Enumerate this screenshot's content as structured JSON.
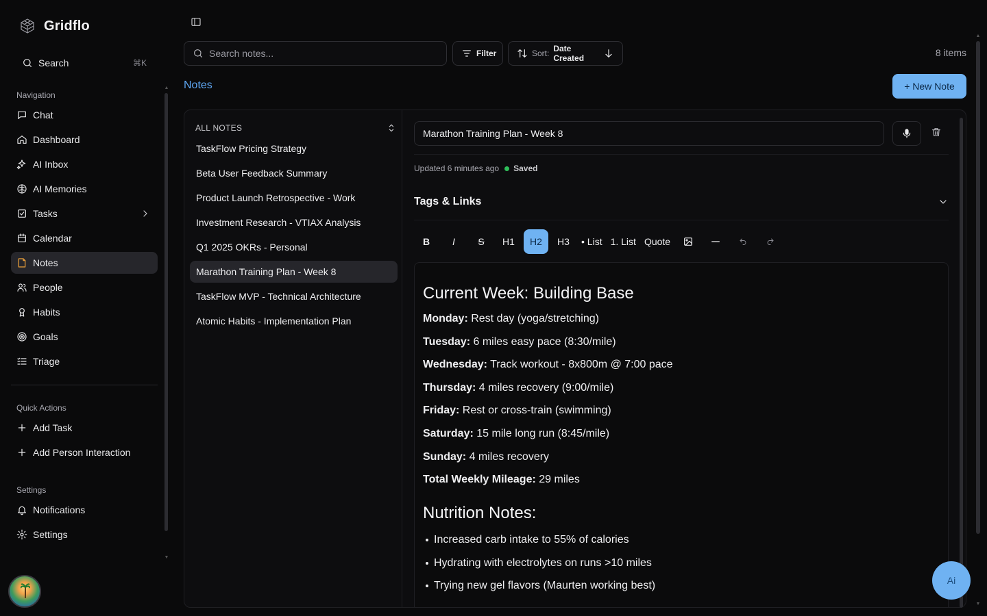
{
  "app": {
    "name": "Gridflo"
  },
  "sidebar": {
    "search": {
      "label": "Search",
      "shortcut": "⌘K"
    },
    "navigation_title": "Navigation",
    "nav_items": [
      {
        "label": "Chat",
        "icon": "chat-icon"
      },
      {
        "label": "Dashboard",
        "icon": "home-icon"
      },
      {
        "label": "AI Inbox",
        "icon": "sparkles-icon"
      },
      {
        "label": "AI Memories",
        "icon": "brain-icon"
      },
      {
        "label": "Tasks",
        "icon": "checkbox-icon"
      },
      {
        "label": "Calendar",
        "icon": "calendar-icon"
      },
      {
        "label": "Notes",
        "icon": "note-icon",
        "active": true
      },
      {
        "label": "People",
        "icon": "people-icon"
      },
      {
        "label": "Habits",
        "icon": "award-icon"
      },
      {
        "label": "Goals",
        "icon": "target-icon"
      },
      {
        "label": "Triage",
        "icon": "list-check-icon"
      }
    ],
    "quick_actions_title": "Quick Actions",
    "quick_actions": [
      {
        "label": "Add Task",
        "icon": "plus-icon"
      },
      {
        "label": "Add Person Interaction",
        "icon": "plus-icon"
      }
    ],
    "settings_title": "Settings",
    "settings_items": [
      {
        "label": "Notifications",
        "icon": "bell-icon"
      },
      {
        "label": "Settings",
        "icon": "gear-icon"
      }
    ]
  },
  "toolbar": {
    "search_placeholder": "Search notes...",
    "filter_label": "Filter",
    "sort_prefix": "Sort:",
    "sort_value": "Date Created",
    "item_count": "8 items"
  },
  "page": {
    "title": "Notes",
    "new_note_label": "+ New Note"
  },
  "notes_list": {
    "header": "ALL NOTES",
    "items": [
      "TaskFlow Pricing Strategy",
      "Beta User Feedback Summary",
      "Product Launch Retrospective - Work",
      "Investment Research - VTIAX Analysis",
      "Q1 2025 OKRs - Personal",
      "Marathon Training Plan - Week 8",
      "TaskFlow MVP - Technical Architecture",
      "Atomic Habits - Implementation Plan"
    ],
    "active_index": 5
  },
  "editor": {
    "title_value": "Marathon Training Plan - Week 8",
    "updated_text": "Updated 6 minutes ago",
    "saved_text": "Saved",
    "tags_label": "Tags & Links",
    "format_buttons": [
      "B",
      "I",
      "S",
      "H1",
      "H2",
      "H3",
      "• List",
      "1. List",
      "Quote"
    ],
    "active_format": "H2",
    "content": {
      "heading1": "Current Week: Building Base",
      "schedule": [
        {
          "day": "Monday:",
          "text": " Rest day (yoga/stretching)"
        },
        {
          "day": "Tuesday:",
          "text": " 6 miles easy pace (8:30/mile)"
        },
        {
          "day": "Wednesday:",
          "text": " Track workout - 8x800m @ 7:00 pace"
        },
        {
          "day": "Thursday:",
          "text": " 4 miles recovery (9:00/mile)"
        },
        {
          "day": "Friday:",
          "text": " Rest or cross-train (swimming)"
        },
        {
          "day": "Saturday:",
          "text": " 15 mile long run (8:45/mile)"
        },
        {
          "day": "Sunday:",
          "text": " 4 miles recovery"
        },
        {
          "day": "Total Weekly Mileage:",
          "text": " 29 miles"
        }
      ],
      "heading2": "Nutrition Notes:",
      "bullets": [
        "Increased carb intake to 55% of calories",
        "Hydrating with electrolytes on runs >10 miles",
        "Trying new gel flavors (Maurten working best)"
      ]
    }
  },
  "ai_button_label": "Ai",
  "colors": {
    "accent": "#6fb2f2",
    "link": "#5fa8f5",
    "saved_dot": "#2fbf5a"
  }
}
